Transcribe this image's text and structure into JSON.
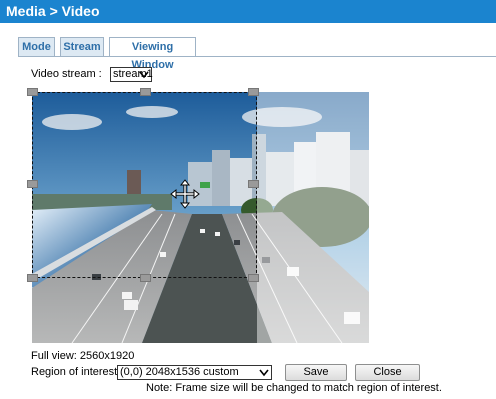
{
  "header": {
    "title": "Media  > Video"
  },
  "tabs": [
    {
      "label": "Mode",
      "active": false
    },
    {
      "label": "Stream",
      "active": false
    },
    {
      "label": "Viewing Window",
      "active": true
    }
  ],
  "stream": {
    "label": "Video stream :",
    "value": "stream1"
  },
  "info": {
    "full_view": "Full view: 2560x1920"
  },
  "roi": {
    "label": "Region of interest :",
    "value": "(0,0) 2048x1536 custom",
    "save_label": "Save",
    "close_label": "Close",
    "note": "Note: Frame size will be changed to match region of interest."
  },
  "icons": {
    "move": "move-cross-icon",
    "dropdown": "chevron-down-icon"
  },
  "colors": {
    "header_bg": "#1b84cf",
    "tab_text": "#2e6fa8"
  }
}
